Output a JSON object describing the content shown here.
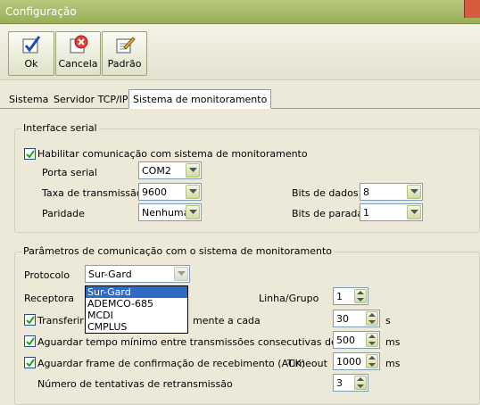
{
  "window": {
    "title": "Configuração"
  },
  "toolbar": {
    "ok": "Ok",
    "cancel": "Cancela",
    "default": "Padrão"
  },
  "tabs": [
    "Sistema",
    "Servidor TCP/IP",
    "Sistema de monitoramento"
  ],
  "serial": {
    "legend": "Interface serial",
    "enable_label": "Habilitar comunicação com sistema de monitoramento",
    "port_label": "Porta serial",
    "port_value": "COM2",
    "baud_label": "Taxa de transmissão",
    "baud_value": "9600",
    "parity_label": "Paridade",
    "parity_value": "Nenhuma",
    "databits_label": "Bits de dados",
    "databits_value": "8",
    "stopbits_label": "Bits de parada",
    "stopbits_value": "1"
  },
  "params": {
    "legend": "Parâmetros de comunicação com o sistema de monitoramento",
    "protocol_label": "Protocolo",
    "protocol_value": "Sur-Gard",
    "receiver_label": "Receptora",
    "line_label": "Linha/Grupo",
    "line_value": "1",
    "transfer_left": "Transferir fr",
    "transfer_right": "mente a cada",
    "transfer_value": "30",
    "transfer_unit": "s",
    "min_wait_label": "Aguardar tempo mínimo entre transmissões consecutivas de",
    "min_wait_value": "500",
    "min_wait_unit": "ms",
    "ack_label": "Aguardar frame de confirmação de recebimento (ACK)",
    "timeout_label": "Timeout",
    "timeout_value": "1000",
    "timeout_unit": "ms",
    "retries_label": "Número de tentativas de retransmissão",
    "retries_value": "3"
  },
  "protocol_options": [
    "Sur-Gard",
    "ADEMCO-685",
    "MCDI",
    "CMPLUS"
  ]
}
